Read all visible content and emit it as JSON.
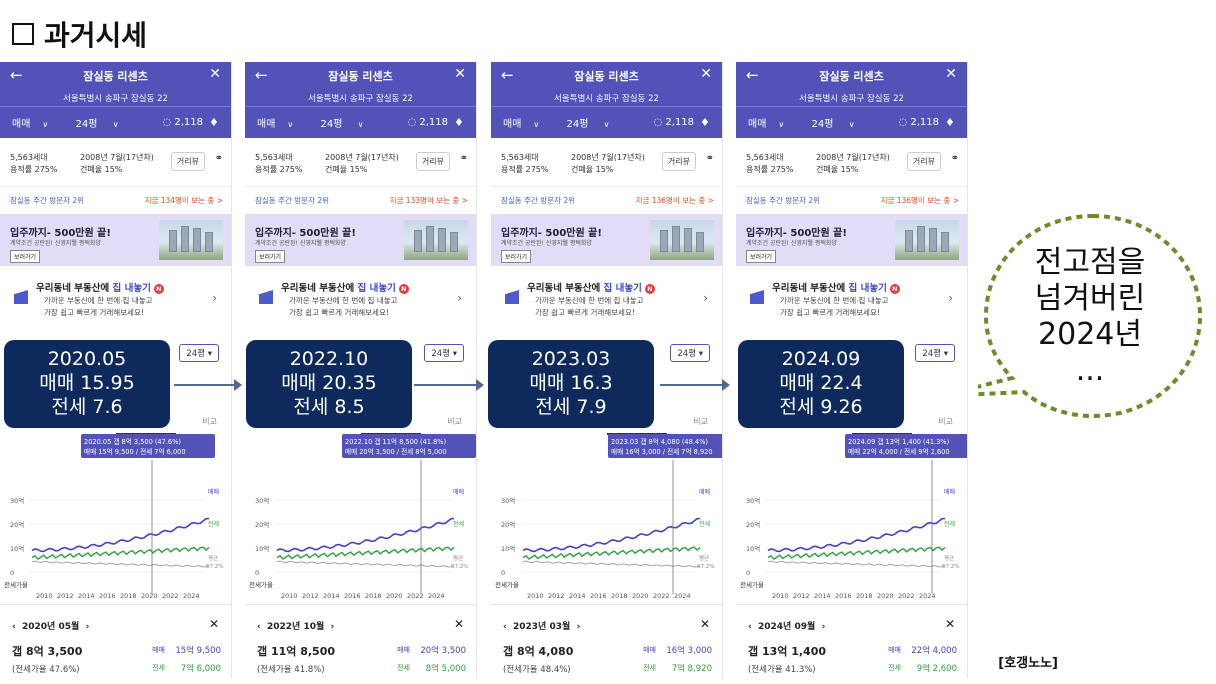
{
  "title": "과거시세",
  "credit": "[호갱노노]",
  "common": {
    "apt_name": "잠실동 리센츠",
    "address": "서울특별시 송파구 잠실동 22",
    "trade": "매매",
    "size": "24평",
    "comments": "2,118",
    "households": "5,563세대",
    "floor_ratio": "용적률 275%",
    "built": "2008년 7월(17년차)",
    "cover_ratio": "건폐율 15%",
    "street_view": "거리뷰",
    "visitor_rank": "잠실동 주간 방문자 2위",
    "banner_title": "입주까지- 500만원 끝!",
    "banner_sub": "계약조건 공란된! 신영지웰 평택화양",
    "banner_btn": "보러가기",
    "home_title_a": "우리동네 부동산에",
    "home_title_b": "집 내놓기",
    "home_badge": "N",
    "home_line1": "가까운 부동산에 한 번에 집 내놓고",
    "home_line2": "가장 쉽고 빠르게 거래해보세요!",
    "size_btn": "24평",
    "compare": "비교",
    "label_sale": "매매",
    "label_rent": "전세",
    "label_ratio": "전세가율",
    "label_avg": "평균",
    "avg_ratio": "57.2%",
    "y_ticks": [
      "30억",
      "20억",
      "10억",
      "0"
    ],
    "x_ticks": [
      "2010",
      "2012",
      "2014",
      "2016",
      "2018",
      "2020",
      "2022",
      "2024"
    ]
  },
  "phones": [
    {
      "visitors_now": "지금 134명이 보는 중 >",
      "tooltip1": "2020.05  갭 8억 3,500 (47.6%)",
      "tooltip2": "매매 15억 9,500 / 전세 7억 6,000",
      "date_nav": "2020년 05월",
      "gap": "갭 8억 3,500",
      "ratio": "(전세가율 47.6%)",
      "sale": "15억 9,500",
      "rent": "7억 6,000",
      "callout": [
        "2020.05",
        "매매 15.95",
        "전세 7.6"
      ]
    },
    {
      "visitors_now": "지금 133명이 보는 중 >",
      "tooltip1": "2022.10  갭 11억 8,500 (41.8%)",
      "tooltip2": "매매 20억 3,500 / 전세 8억 5,000",
      "date_nav": "2022년 10월",
      "gap": "갭 11억 8,500",
      "ratio": "(전세가율 41.8%)",
      "sale": "20억 3,500",
      "rent": "8억 5,000",
      "callout": [
        "2022.10",
        "매매 20.35",
        "전세 8.5"
      ]
    },
    {
      "visitors_now": "지금 136명이 보는 중 >",
      "tooltip1": "2023.03  갭 8억 4,080 (48.4%)",
      "tooltip2": "매매 16억 3,000 / 전세 7억 8,920",
      "date_nav": "2023년 03월",
      "gap": "갭 8억 4,080",
      "ratio": "(전세가율 48.4%)",
      "sale": "16억 3,000",
      "rent": "7억 8,920",
      "callout": [
        "2023.03",
        "매매 16.3",
        "전세 7.9"
      ]
    },
    {
      "visitors_now": "지금 136명이 보는 중 >",
      "tooltip1": "2024.09  갭 13억 1,400 (41.3%)",
      "tooltip2": "매매 22억 4,000 / 전세 9억 2,600",
      "date_nav": "2024년 09월",
      "gap": "갭 13억 1,400",
      "ratio": "(전세가율 41.3%)",
      "sale": "22억 4,000",
      "rent": "9억 2,600",
      "callout": [
        "2024.09",
        "매매 22.4",
        "전세 9.26"
      ]
    }
  ],
  "bubble": [
    "전고점을",
    "넘겨버린",
    "2024년",
    "..."
  ]
}
